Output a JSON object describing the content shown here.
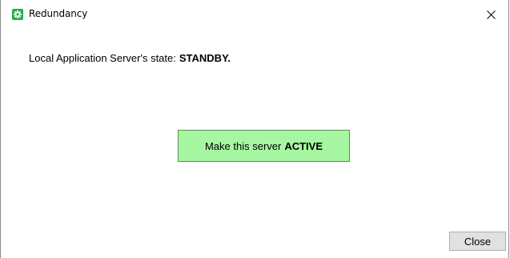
{
  "window": {
    "title": "Redundancy",
    "app_icon": "green-cross-app-icon",
    "close_icon": "close-icon"
  },
  "status": {
    "label": "Local Application Server's state:",
    "value": "STANDBY."
  },
  "actions": {
    "activate_label_prefix": "Make this server",
    "activate_label_emphasis": "ACTIVE",
    "activate_color": "#a7f7a2",
    "close_label": "Close"
  }
}
